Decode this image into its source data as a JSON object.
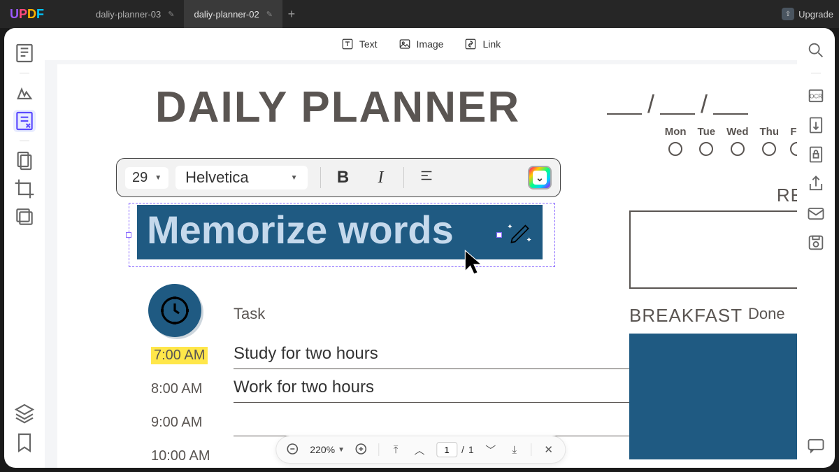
{
  "app": {
    "logo": "UPDF"
  },
  "tabs": [
    {
      "label": "daliy-planner-03",
      "active": false
    },
    {
      "label": "daliy-planner-02",
      "active": true
    }
  ],
  "upgrade": {
    "label": "Upgrade"
  },
  "tools": {
    "text": "Text",
    "image": "Image",
    "link": "Link"
  },
  "format_bar": {
    "font_size": "29",
    "font_family": "Helvetica"
  },
  "document": {
    "title": "DAILY PLANNER",
    "days": [
      "Mon",
      "Tue",
      "Wed",
      "Thu",
      "Fri"
    ],
    "editing_text": "Memorize words",
    "sections": {
      "remember": "REME",
      "breakfast": "BREAKFAST"
    },
    "task_header": {
      "task": "Task",
      "done": "Done"
    },
    "tasks": [
      {
        "time": "7:00 AM",
        "text": "Study for two hours",
        "highlight": true
      },
      {
        "time": "8:00 AM",
        "text": "Work for two hours",
        "highlight": false
      },
      {
        "time": "9:00 AM",
        "text": "",
        "highlight": false
      },
      {
        "time": "10:00 AM",
        "text": "",
        "highlight": false
      }
    ]
  },
  "zoom_bar": {
    "zoom": "220%",
    "page_current": "1",
    "page_total": "1",
    "page_sep": "/"
  },
  "icons": {
    "tab_edit": "✎",
    "plus": "+",
    "caret": "▼",
    "minus": "−",
    "close": "✕"
  }
}
